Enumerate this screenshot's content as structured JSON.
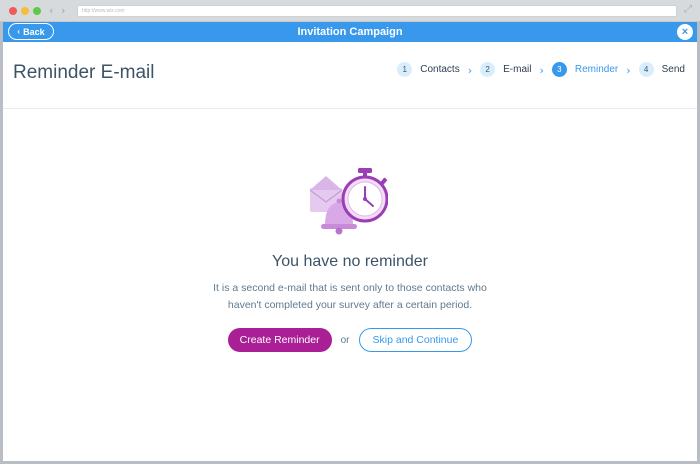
{
  "browser": {
    "url": "http://www.wix.com",
    "nav_back_icon": "‹",
    "nav_forward_icon": "›",
    "expand_icon": "⤢"
  },
  "header": {
    "back_label": "Back",
    "back_icon": "‹",
    "title": "Invitation Campaign",
    "close_icon": "×",
    "accent_color": "#3899ec"
  },
  "page": {
    "title": "Reminder E-mail"
  },
  "steps": [
    {
      "number": "1",
      "label": "Contacts",
      "active": false
    },
    {
      "number": "2",
      "label": "E-mail",
      "active": false
    },
    {
      "number": "3",
      "label": "Reminder",
      "active": true
    },
    {
      "number": "4",
      "label": "Send",
      "active": false
    }
  ],
  "step_separator_icon": "›",
  "empty_state": {
    "illustration_icon": "reminder-bell-stopwatch-icon",
    "title": "You have no reminder",
    "description_line1": "It is a second e-mail that is sent only to those contacts who",
    "description_line2": "haven't completed your survey after a certain period."
  },
  "actions": {
    "create_label": "Create Reminder",
    "create_color": "#aa1e96",
    "or_label": "or",
    "skip_label": "Skip and Continue"
  }
}
